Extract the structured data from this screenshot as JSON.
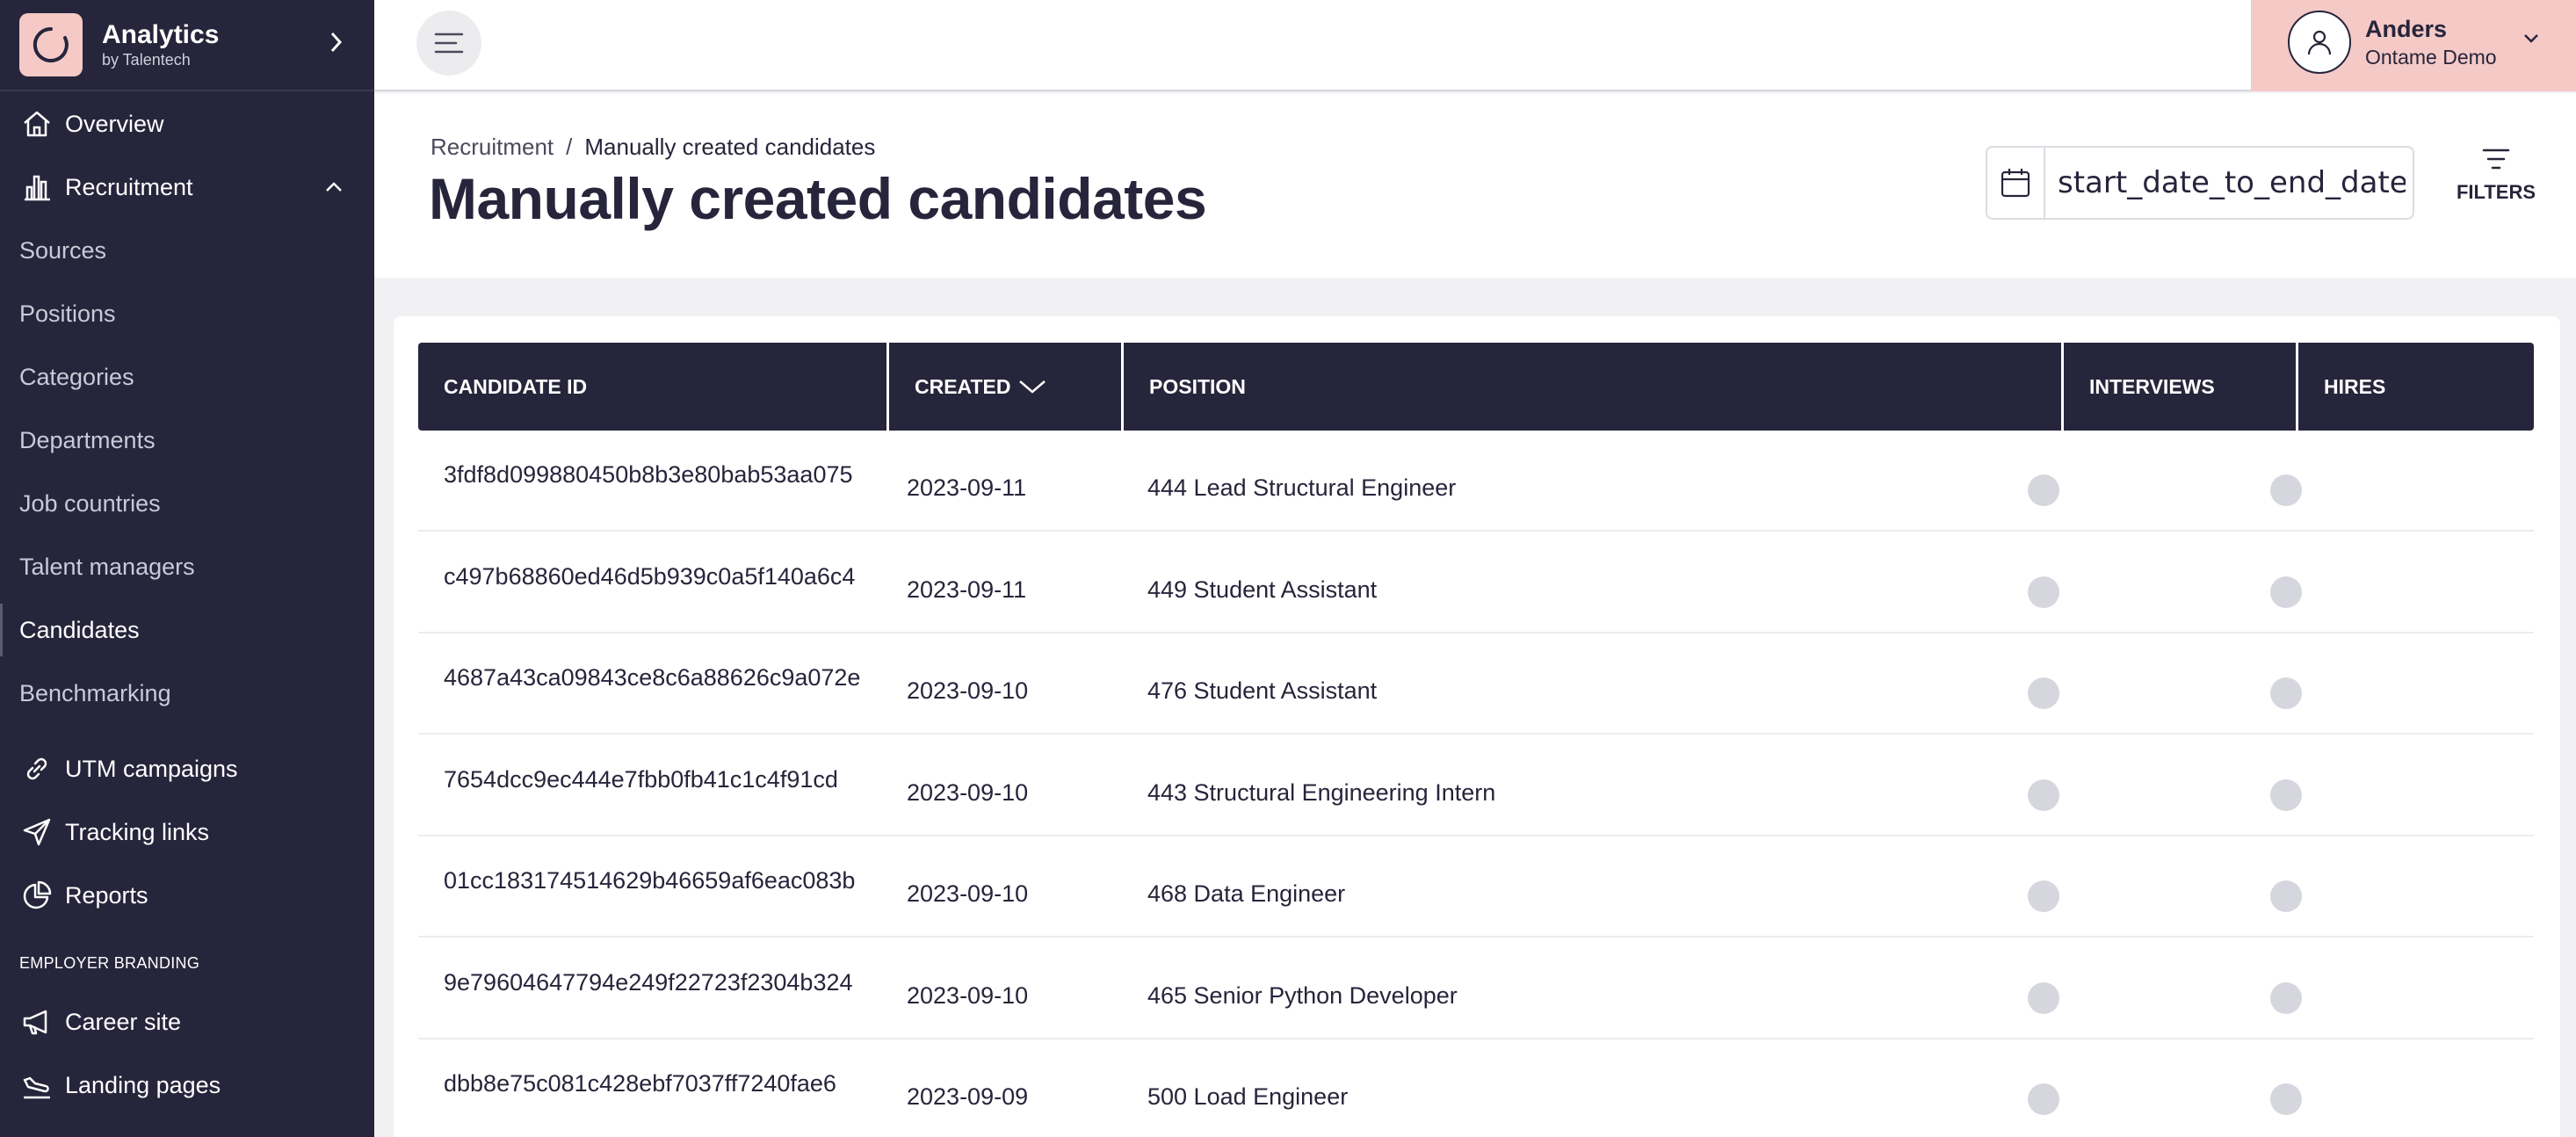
{
  "brand": {
    "name": "Analytics",
    "sub": "by Talentech"
  },
  "sidebar": {
    "overview": "Overview",
    "recruitment": "Recruitment",
    "sub_items": [
      {
        "label": "Sources"
      },
      {
        "label": "Positions"
      },
      {
        "label": "Categories"
      },
      {
        "label": "Departments"
      },
      {
        "label": "Job countries"
      },
      {
        "label": "Talent managers"
      },
      {
        "label": "Candidates"
      },
      {
        "label": "Benchmarking"
      }
    ],
    "utm": "UTM campaigns",
    "tracking": "Tracking links",
    "reports": "Reports",
    "section_employer": "EMPLOYER BRANDING",
    "career": "Career site",
    "landing": "Landing pages"
  },
  "user": {
    "name": "Anders",
    "org": "Ontame Demo"
  },
  "breadcrumb": {
    "parent": "Recruitment",
    "separator": "/",
    "current": "Manually created candidates"
  },
  "page": {
    "title": "Manually created candidates"
  },
  "date_filter": {
    "value": "start_date_to_end_date"
  },
  "filters": {
    "label": "FILTERS"
  },
  "table": {
    "columns": {
      "id": "CANDIDATE ID",
      "created": "CREATED",
      "position": "POSITION",
      "interviews": "INTERVIEWS",
      "hires": "HIRES"
    },
    "rows": [
      {
        "id": "3fdf8d099880450b8b3e80bab53aa075",
        "created": "2023-09-11",
        "position": "444 Lead Structural Engineer"
      },
      {
        "id": "c497b68860ed46d5b939c0a5f140a6c4",
        "created": "2023-09-11",
        "position": "449 Student Assistant"
      },
      {
        "id": "4687a43ca09843ce8c6a88626c9a072e",
        "created": "2023-09-10",
        "position": "476 Student Assistant"
      },
      {
        "id": "7654dcc9ec444e7fbb0fb41c1c4f91cd",
        "created": "2023-09-10",
        "position": "443 Structural Engineering Intern"
      },
      {
        "id": "01cc183174514629b46659af6eac083b",
        "created": "2023-09-10",
        "position": "468 Data Engineer"
      },
      {
        "id": "9e79604647794e249f22723f2304b324",
        "created": "2023-09-10",
        "position": "465 Senior Python Developer"
      },
      {
        "id": "dbb8e75c081c428ebf7037ff7240fae6",
        "created": "2023-09-09",
        "position": "500 Load Engineer"
      }
    ]
  },
  "colors": {
    "sidebar_bg": "#26253b",
    "accent_pink": "#f4c9c6",
    "status_dot": "#d6d6de"
  }
}
